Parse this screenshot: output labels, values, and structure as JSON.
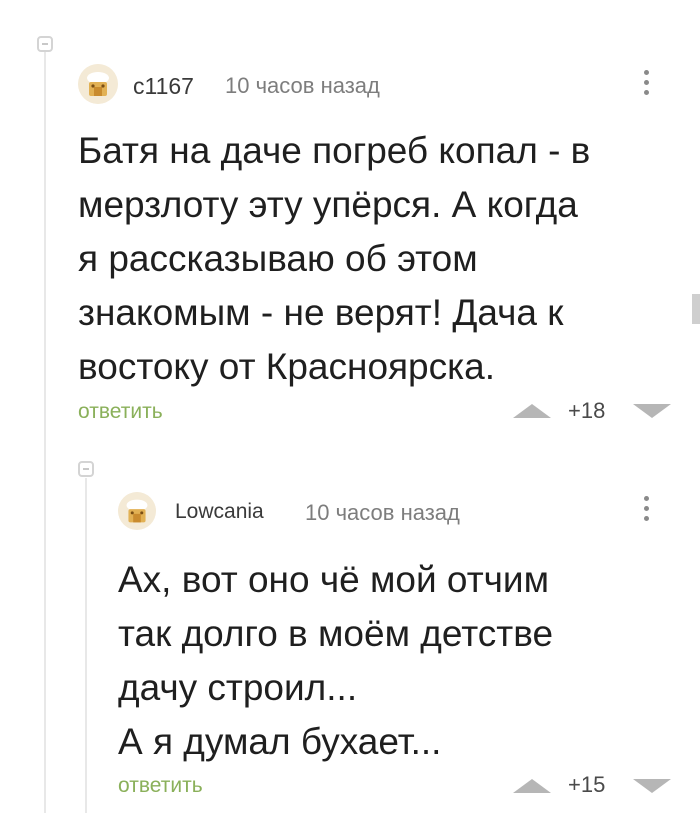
{
  "comments": [
    {
      "username": "c1167",
      "time": "10 часов назад",
      "lines": [
        "Батя на даче погреб копал - в",
        "мерзлоту эту упёрся. А когда",
        "я рассказываю об этом",
        "знакомым - не верят! Дача к",
        "востоку от Красноярска."
      ],
      "reply_label": "ответить",
      "rating": "+18"
    },
    {
      "username": "Lowcania",
      "time": "10 часов назад",
      "lines": [
        "Ах, вот оно чё мой отчим",
        "так долго в моём детстве",
        "дачу строил...",
        "А я думал бухает..."
      ],
      "reply_label": "ответить",
      "rating": "+15"
    }
  ],
  "colors": {
    "reply_link": "#8ab05a",
    "vote_arrow": "#b6b6b6",
    "meta_text": "#7d7d7d"
  },
  "icons": {
    "collapse": "collapse-thread-icon",
    "more": "more-vertical-icon",
    "vote_up": "arrow-up-icon",
    "vote_down": "arrow-down-icon"
  }
}
